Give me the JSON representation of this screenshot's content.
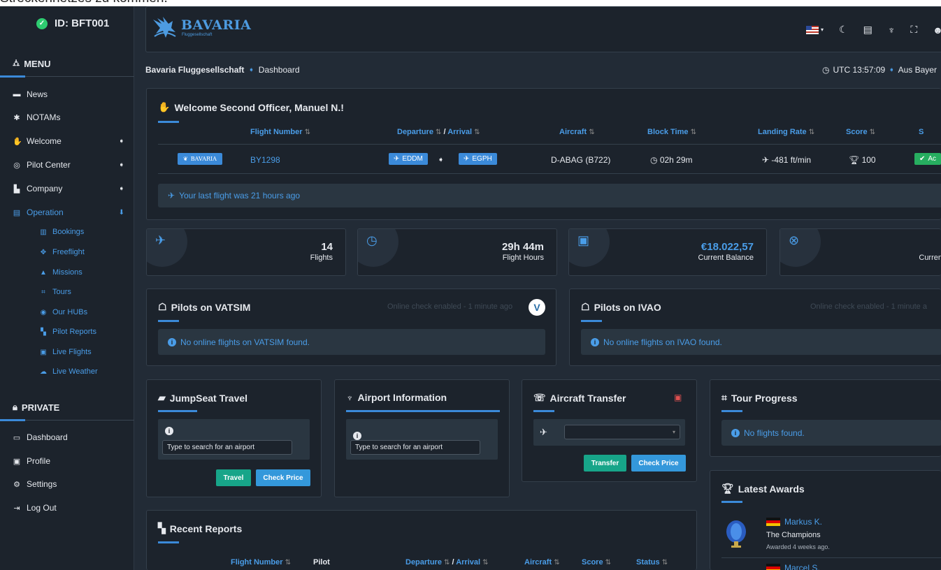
{
  "top_text": "Streckennetzes zu kommen.",
  "sidebar": {
    "id": "ID: BFT001",
    "menu_title": "MENU",
    "items": [
      {
        "label": "News"
      },
      {
        "label": "NOTAMs"
      },
      {
        "label": "Welcome"
      },
      {
        "label": "Pilot Center"
      },
      {
        "label": "Company"
      },
      {
        "label": "Operation"
      }
    ],
    "sub_items": [
      {
        "label": "Bookings"
      },
      {
        "label": "Freeflight"
      },
      {
        "label": "Missions"
      },
      {
        "label": "Tours"
      },
      {
        "label": "Our HUBs"
      },
      {
        "label": "Pilot Reports"
      },
      {
        "label": "Live Flights"
      },
      {
        "label": "Live Weather"
      }
    ],
    "private_title": "PRIVATE",
    "private_items": [
      {
        "label": "Dashboard"
      },
      {
        "label": "Profile"
      },
      {
        "label": "Settings"
      },
      {
        "label": "Log Out"
      }
    ]
  },
  "header": {
    "logo_big": "BAVARIA",
    "logo_small": "Fluggesellschaft"
  },
  "breadcrumb": {
    "root": "Bavaria Fluggesellschaft",
    "current": "Dashboard",
    "utc": "UTC 13:57:09",
    "location": "Aus Bayer"
  },
  "welcome": {
    "title": "Welcome Second Officer, Manuel N.!",
    "cols": {
      "flight_number": "Flight Number",
      "departure": "Departure",
      "slash": "/",
      "arrival": "Arrival",
      "aircraft": "Aircraft",
      "block_time": "Block Time",
      "landing_rate": "Landing Rate",
      "score": "Score",
      "status_cut": "S"
    },
    "row": {
      "airline": "BAVARIA",
      "flight": "BY1298",
      "dep": "EDDM",
      "arr": "EGPH",
      "aircraft": "D-ABAG (B722)",
      "block": "02h 29m",
      "landing": "-481 ft/min",
      "score": "100",
      "status_cut": "Ac"
    },
    "last_flight": "Your last flight was 21 hours ago"
  },
  "stats": [
    {
      "value": "14",
      "label": "Flights"
    },
    {
      "value": "29h 44m",
      "label": "Flight Hours"
    },
    {
      "value": "€18.022,57",
      "label": "Current Balance"
    },
    {
      "value": "",
      "label": "Curren"
    }
  ],
  "vatsim": {
    "title": "Pilots on VATSIM",
    "check": "Online check enabled - 1 minute ago",
    "info": "No online flights on VATSIM found."
  },
  "ivao": {
    "title": "Pilots on IVAO",
    "check": "Online check enabled - 1 minute a",
    "info": "No online flights on IVAO found."
  },
  "jumpseat": {
    "title": "JumpSeat Travel",
    "placeholder": "Type to search for an airport",
    "travel": "Travel",
    "check": "Check Price"
  },
  "airport": {
    "title": "Airport Information",
    "placeholder": "Type to search for an airport"
  },
  "transfer": {
    "title": "Aircraft Transfer",
    "transfer": "Transfer",
    "check": "Check Price"
  },
  "tour": {
    "title": "Tour Progress",
    "info": "No flights found."
  },
  "awards": {
    "title": "Latest Awards",
    "items": [
      {
        "name": "Markus K.",
        "award": "The Champions",
        "when": "Awarded 4 weeks ago."
      },
      {
        "name": "Marcel S."
      }
    ]
  },
  "reports": {
    "title": "Recent Reports",
    "cols": {
      "flight_number": "Flight Number",
      "pilot": "Pilot",
      "departure": "Departure",
      "slash": "/",
      "arrival": "Arrival",
      "aircraft": "Aircraft",
      "score": "Score",
      "status": "Status"
    }
  },
  "colors": {
    "accent": "#3b8ad9",
    "panel": "#1c232c",
    "background": "#222b36"
  }
}
